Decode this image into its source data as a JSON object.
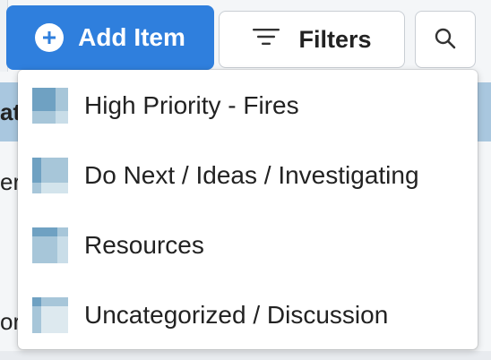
{
  "background": {
    "row1_fragment": "at",
    "row2_fragment": "er",
    "row3_fragment": "or",
    "header_band_color": "#a9c7df"
  },
  "toolbar": {
    "add_label": "Add Item",
    "add_icon": "plus-circle-icon",
    "filters_label": "Filters",
    "filters_icon": "filter-lines-icon",
    "search_icon": "search-icon",
    "accent_color": "#2f7fdd"
  },
  "menu": {
    "items": [
      {
        "label": "High Priority - Fires",
        "icon": "section-grid-icon"
      },
      {
        "label": "Do Next / Ideas / Investigating",
        "icon": "section-grid-icon"
      },
      {
        "label": "Resources",
        "icon": "section-grid-icon"
      },
      {
        "label": "Uncategorized / Discussion",
        "icon": "section-grid-icon"
      }
    ]
  }
}
